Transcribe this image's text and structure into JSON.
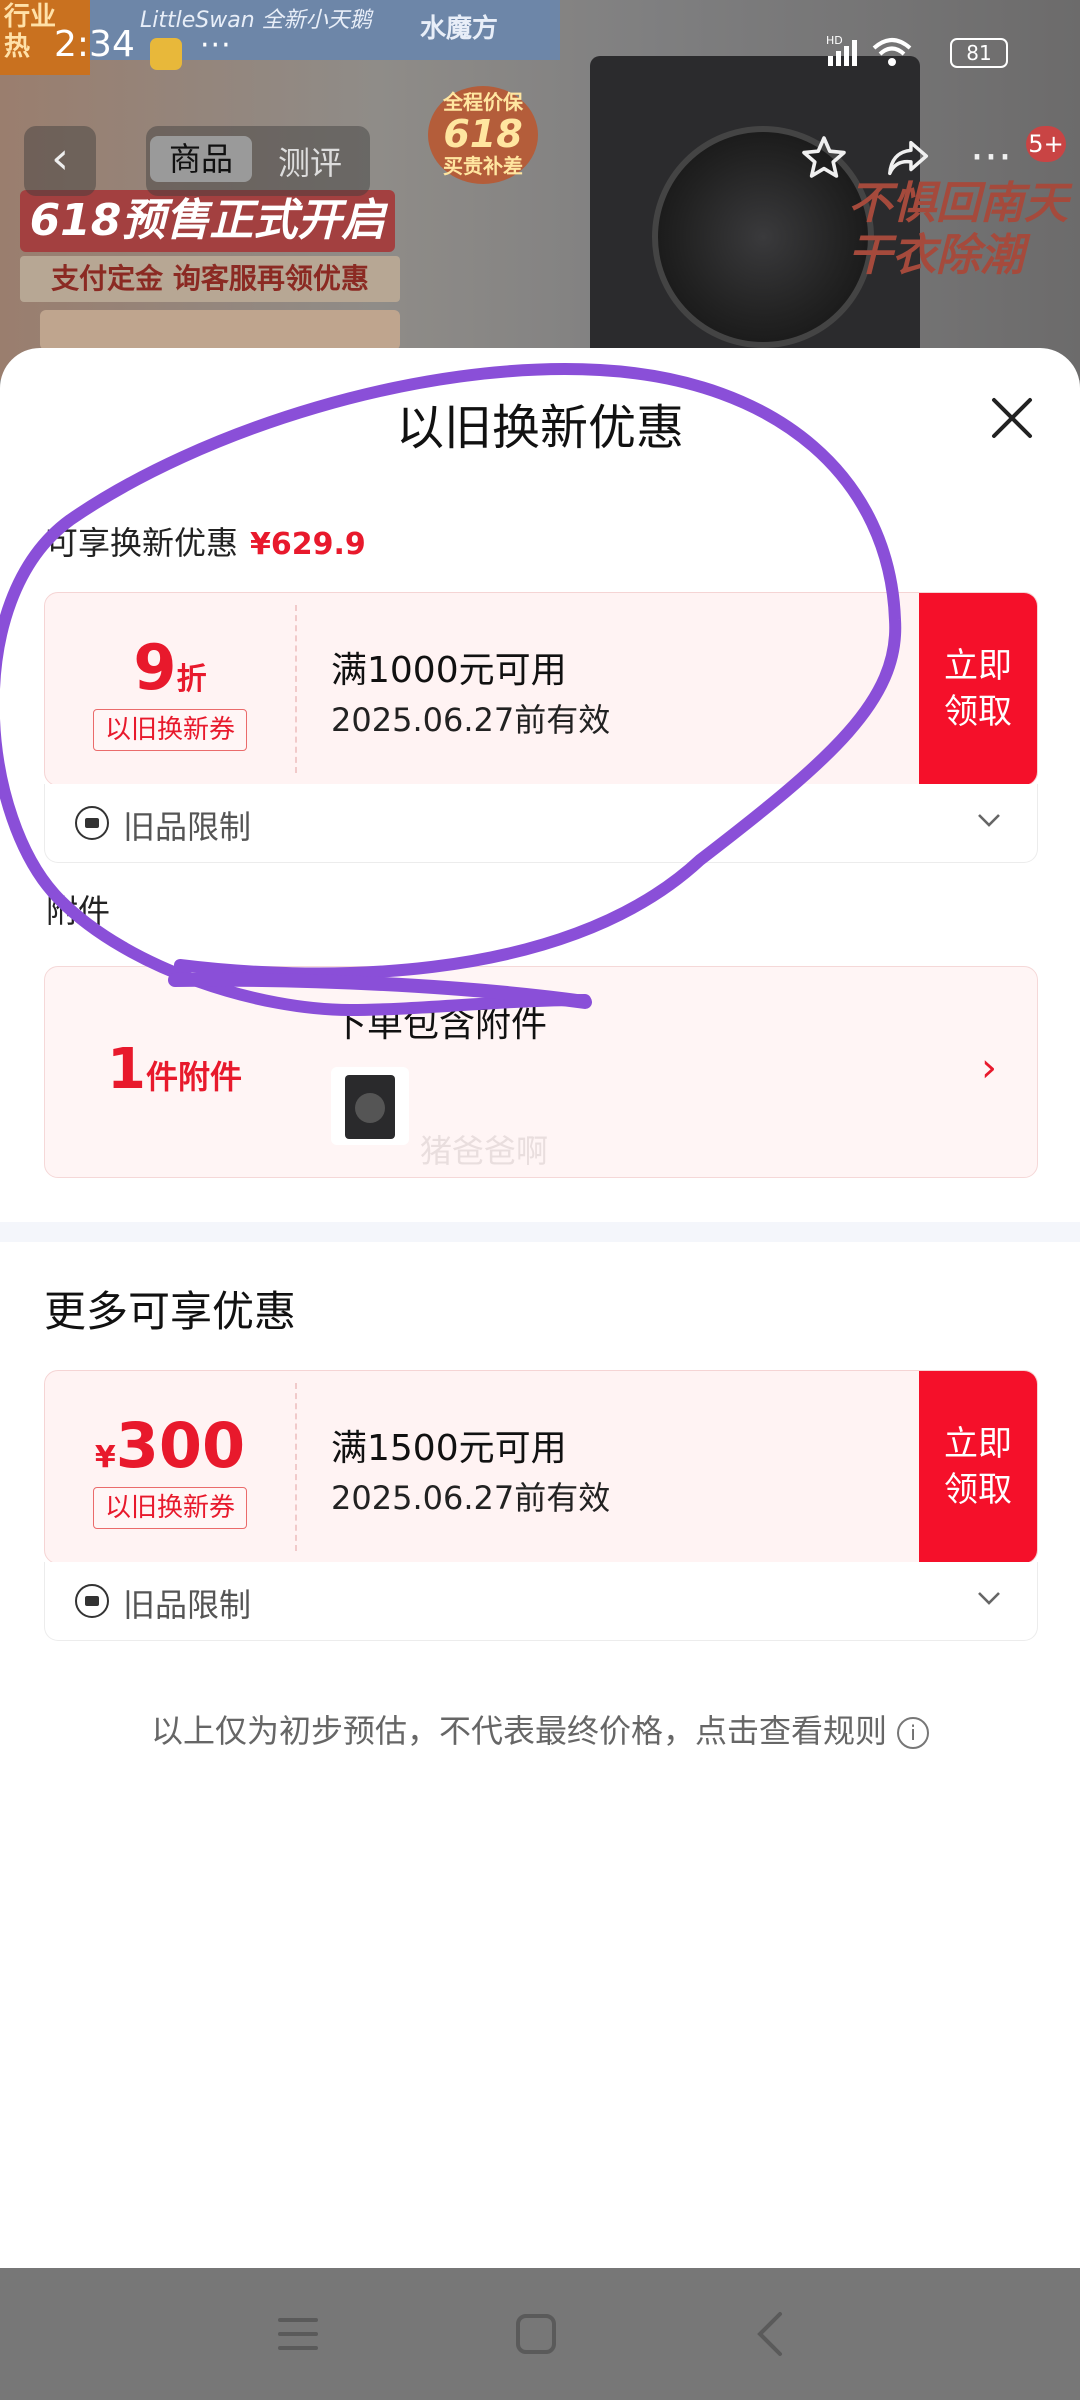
{
  "status_bar": {
    "time": "2:34",
    "dots": "···",
    "signal": "HD",
    "battery": "81"
  },
  "background": {
    "corner_text": "行业\n热",
    "brand_text": "LittleSwan 全新小天鹅",
    "brand2_text": "水魔方",
    "badge_top": "全程价保",
    "badge_mid": "618",
    "badge_bot": "买贵补差",
    "headline": "618预售正式开启",
    "subline": "支付定金 询客服再领优惠",
    "slogan": "不惧回南天\n干衣除潮"
  },
  "topbar": {
    "tabs": [
      {
        "label": "商品",
        "active": true
      },
      {
        "label": "测评",
        "active": false
      }
    ],
    "badge": "5+"
  },
  "sheet": {
    "title": "以旧换新优惠",
    "available_label": "可享换新优惠",
    "available_amount": "¥629.9",
    "coupons": [
      {
        "value": "9",
        "unit": "折",
        "tag": "以旧换新券",
        "condition": "满1000元可用",
        "validity": "2025.06.27前有效",
        "claim": "立即\n领取",
        "limit": "旧品限制"
      },
      {
        "currency": "¥",
        "value": "300",
        "tag": "以旧换新券",
        "condition": "满1500元可用",
        "validity": "2025.06.27前有效",
        "claim": "立即\n领取",
        "limit": "旧品限制"
      }
    ],
    "accessory_section": "附件",
    "accessory": {
      "count": "1",
      "unit": "件附件",
      "title": "下单包含附件"
    },
    "watermark": "猪爸爸啊",
    "more_title": "更多可享优惠",
    "footnote": "以上仅为初步预估，不代表最终价格，点击查看规则",
    "info_glyph": "i"
  },
  "colors": {
    "accent_red": "#f5102a",
    "price_red": "#e8192c",
    "annotation_purple": "#8a4fd8"
  }
}
